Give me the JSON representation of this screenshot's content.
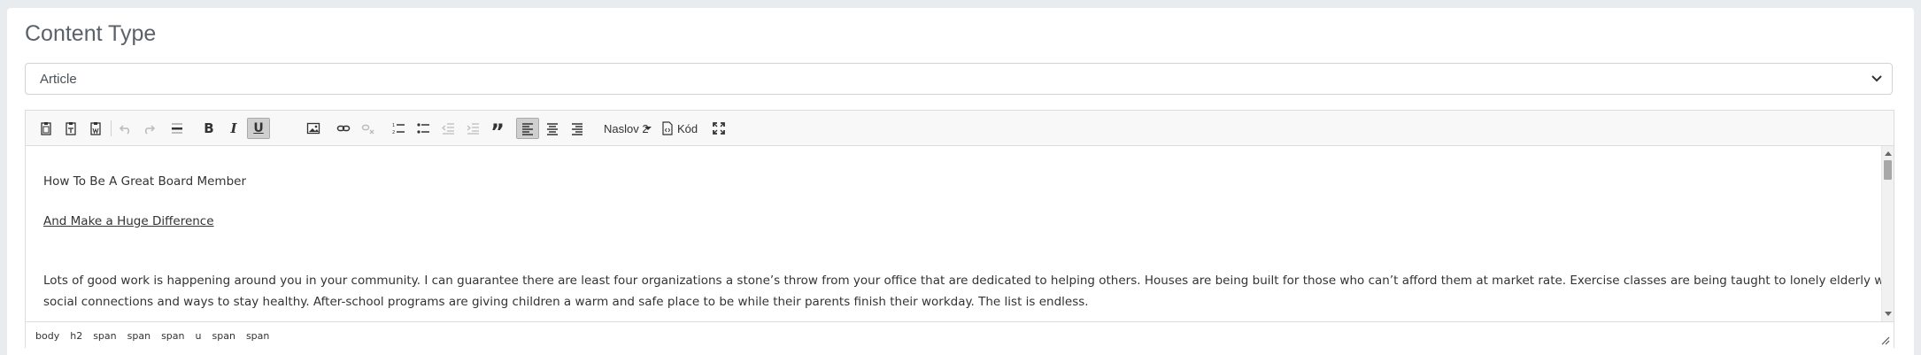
{
  "content_type": {
    "label": "Content Type",
    "selected": "Article"
  },
  "toolbar": {
    "buttons": [
      {
        "name": "paste-icon"
      },
      {
        "name": "paste-text-icon"
      },
      {
        "name": "paste-word-icon"
      },
      {
        "name": "undo-icon"
      },
      {
        "name": "redo-icon"
      },
      {
        "name": "horizontal-rule-icon"
      },
      {
        "name": "bold-icon",
        "glyph": "B"
      },
      {
        "name": "italic-icon",
        "glyph": "I"
      },
      {
        "name": "underline-icon",
        "glyph": "U"
      },
      {
        "name": "image-icon"
      },
      {
        "name": "link-icon"
      },
      {
        "name": "unlink-icon"
      },
      {
        "name": "numbered-list-icon"
      },
      {
        "name": "bulleted-list-icon"
      },
      {
        "name": "outdent-icon"
      },
      {
        "name": "indent-icon"
      },
      {
        "name": "blockquote-icon",
        "glyph": "”"
      },
      {
        "name": "align-left-icon"
      },
      {
        "name": "align-center-icon"
      },
      {
        "name": "align-right-icon"
      },
      {
        "name": "maximize-icon"
      }
    ],
    "format": "Naslov 2",
    "code_label": "Kód"
  },
  "content": {
    "heading": "How To Be A Great Board Member",
    "subheading": "And Make a Huge Difference",
    "paragraph_line1": "Lots of good work is happening around you in your community. I can guarantee there are least four organizations a stone’s throw from your office that are dedicated to helping others.  Houses are being built for those who can’t afford them at market rate. Exercise classes are being taught to lonely elderly who need",
    "paragraph_line2": "social connections and ways to stay healthy. After-school programs are giving children a warm and safe place to be while their parents finish their workday. The list is endless."
  },
  "statusbar": {
    "path": [
      "body",
      "h2",
      "span",
      "span",
      "span",
      "u",
      "span",
      "span"
    ]
  }
}
